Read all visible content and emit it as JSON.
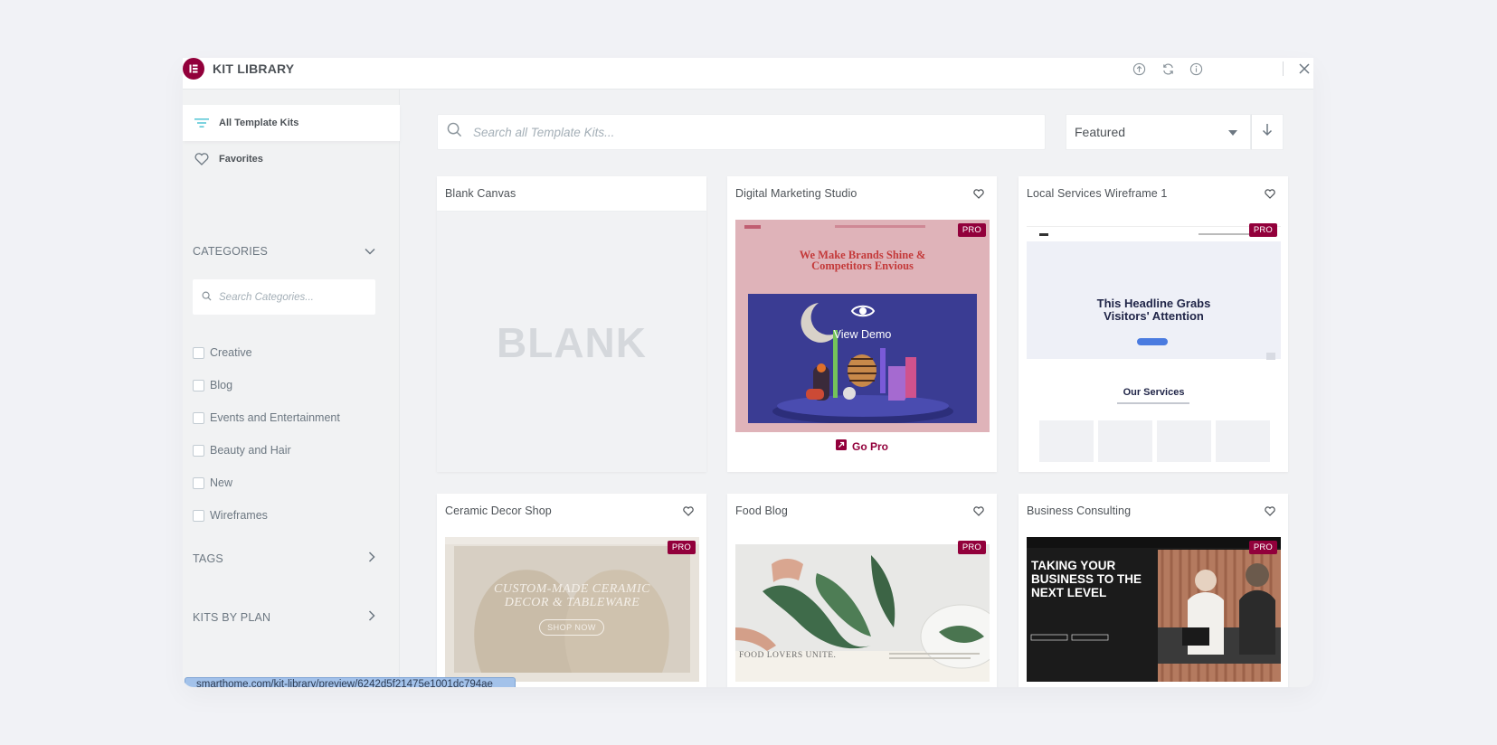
{
  "header": {
    "title": "KIT LIBRARY",
    "icons": [
      "upload-icon",
      "sync-icon",
      "info-icon",
      "close-icon"
    ]
  },
  "sidebar": {
    "nav": [
      {
        "label": "All Template Kits",
        "icon": "filter-icon",
        "active": true
      },
      {
        "label": "Favorites",
        "icon": "heart-icon",
        "active": false
      }
    ],
    "categories_heading": "CATEGORIES",
    "category_search_placeholder": "Search Categories...",
    "categories": [
      "Creative",
      "Blog",
      "Events and Entertainment",
      "Beauty and Hair",
      "New",
      "Wireframes"
    ],
    "tags_heading": "TAGS",
    "kits_by_plan_heading": "KITS BY PLAN"
  },
  "main": {
    "search_placeholder": "Search all Template Kits...",
    "sort_value": "Featured",
    "kits": [
      {
        "title": "Blank Canvas",
        "thumb_text": "BLANK"
      },
      {
        "title": "Digital Marketing Studio",
        "badge": "PRO",
        "hero_text": "We Make Brands Shine & Competitors Envious",
        "overlay_label": "View Demo",
        "cta": "Go Pro"
      },
      {
        "title": "Local Services Wireframe 1",
        "badge": "PRO",
        "headline": "This Headline Grabs Visitors' Attention",
        "section_title": "Our Services"
      },
      {
        "title": "Ceramic Decor Shop",
        "badge": "PRO",
        "hero_text": "CUSTOM-MADE CERAMIC DECOR & TABLEWARE",
        "button": "SHOP NOW"
      },
      {
        "title": "Food Blog",
        "badge": "PRO",
        "caption": "FOOD LOVERS UNITE."
      },
      {
        "title": "Business Consulting",
        "badge": "PRO",
        "headline": "TAKING YOUR BUSINESS TO THE NEXT LEVEL"
      }
    ]
  },
  "status_url": "smarthome.com/kit-library/preview/6242d5f21475e1001dc794ae",
  "colors": {
    "accent": "#92003b",
    "teal": "#5cc8d7",
    "bg": "#f1f2f4"
  }
}
